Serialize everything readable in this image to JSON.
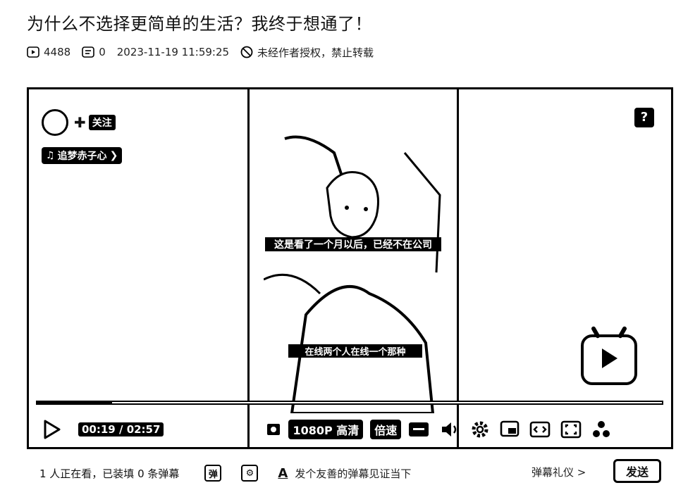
{
  "header": {
    "title": "为什么不选择更简单的生活？我终于想通了！",
    "play_count": "4488",
    "danmaku_count": "0",
    "publish_time": "2023-11-19 11:59:25",
    "rights_notice": "未经作者授权，禁止转载"
  },
  "player": {
    "follow_label": "关注",
    "music_label": "追梦赤子心",
    "help_icon": "?",
    "subtitle_top": "这是看了一个月以后，已经不在公司",
    "subtitle_bottom": "在线两个人在线一个那种",
    "progress_fraction": 0.12,
    "current_time": "00:19",
    "duration": "02:57",
    "quality_label": "1080P 高清",
    "speed_label": "倍速"
  },
  "bottom_bar": {
    "status_text": "1 人正在看，已装填 0 条弹幕",
    "danmaku_input_placeholder": "发个友善的弹幕见证当下",
    "etiquette_label": "弹幕礼仪 >",
    "send_label": "发送"
  }
}
